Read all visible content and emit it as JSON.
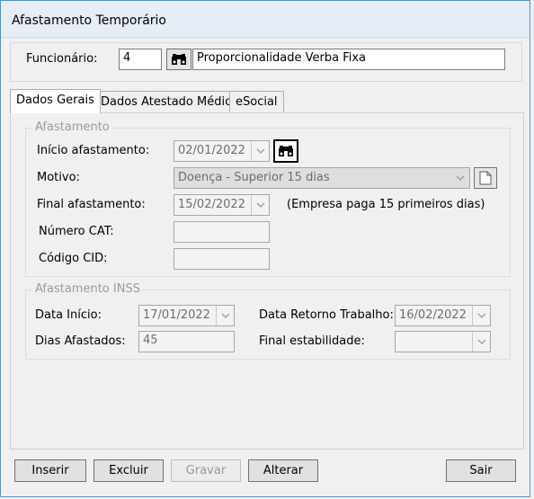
{
  "window": {
    "title": "Afastamento Temporário"
  },
  "header": {
    "funcionario_label": "Funcionário:",
    "funcionario_code": "4",
    "funcionario_name": "Proporcionalidade Verba Fixa"
  },
  "tabs": [
    {
      "label": "Dados Gerais",
      "active": true
    },
    {
      "label": "Dados Atestado Médico",
      "active": false
    },
    {
      "label": "eSocial",
      "active": false
    }
  ],
  "afastamento": {
    "group_title": "Afastamento",
    "inicio_label": "Início afastamento:",
    "inicio_value": "02/01/2022",
    "motivo_label": "Motivo:",
    "motivo_value": "Doença - Superior 15 dias",
    "final_label": "Final afastamento:",
    "final_value": "15/02/2022",
    "final_note": "(Empresa paga 15 primeiros dias)",
    "cat_label": "Número CAT:",
    "cat_value": "",
    "cid_label": "Código CID:",
    "cid_value": ""
  },
  "inss": {
    "group_title": "Afastamento INSS",
    "data_inicio_label": "Data Início:",
    "data_inicio_value": "17/01/2022",
    "data_retorno_label": "Data Retorno Trabalho:",
    "data_retorno_value": "16/02/2022",
    "dias_label": "Dias Afastados:",
    "dias_value": "45",
    "final_estab_label": "Final estabilidade:",
    "final_estab_value": ""
  },
  "buttons": {
    "inserir": "Inserir",
    "excluir": "Excluir",
    "gravar": "Gravar",
    "alterar": "Alterar",
    "sair": "Sair"
  },
  "icons": {
    "search": "binoculars-icon",
    "dropdown": "chevron-down-icon",
    "doc": "document-icon"
  }
}
